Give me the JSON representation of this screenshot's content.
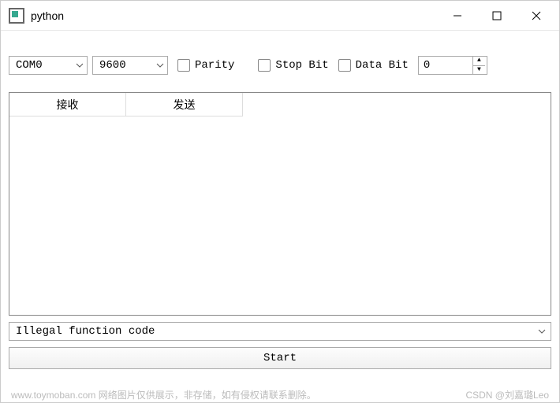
{
  "window": {
    "title": "python"
  },
  "config": {
    "port": "COM0",
    "baud": "9600",
    "parity_label": "Parity",
    "parity_checked": false,
    "stopbit_label": "Stop Bit",
    "stopbit_checked": false,
    "databit_label": "Data Bit",
    "databit_checked": false,
    "spin_value": "0"
  },
  "table": {
    "col1": "接收",
    "col2": "发送"
  },
  "status_combo": "Illegal function code",
  "start_button": "Start",
  "footer": {
    "left": "www.toymoban.com 网络图片仅供展示，非存储，如有侵权请联系删除。",
    "right": "CSDN @刘嘉璐Leo"
  }
}
